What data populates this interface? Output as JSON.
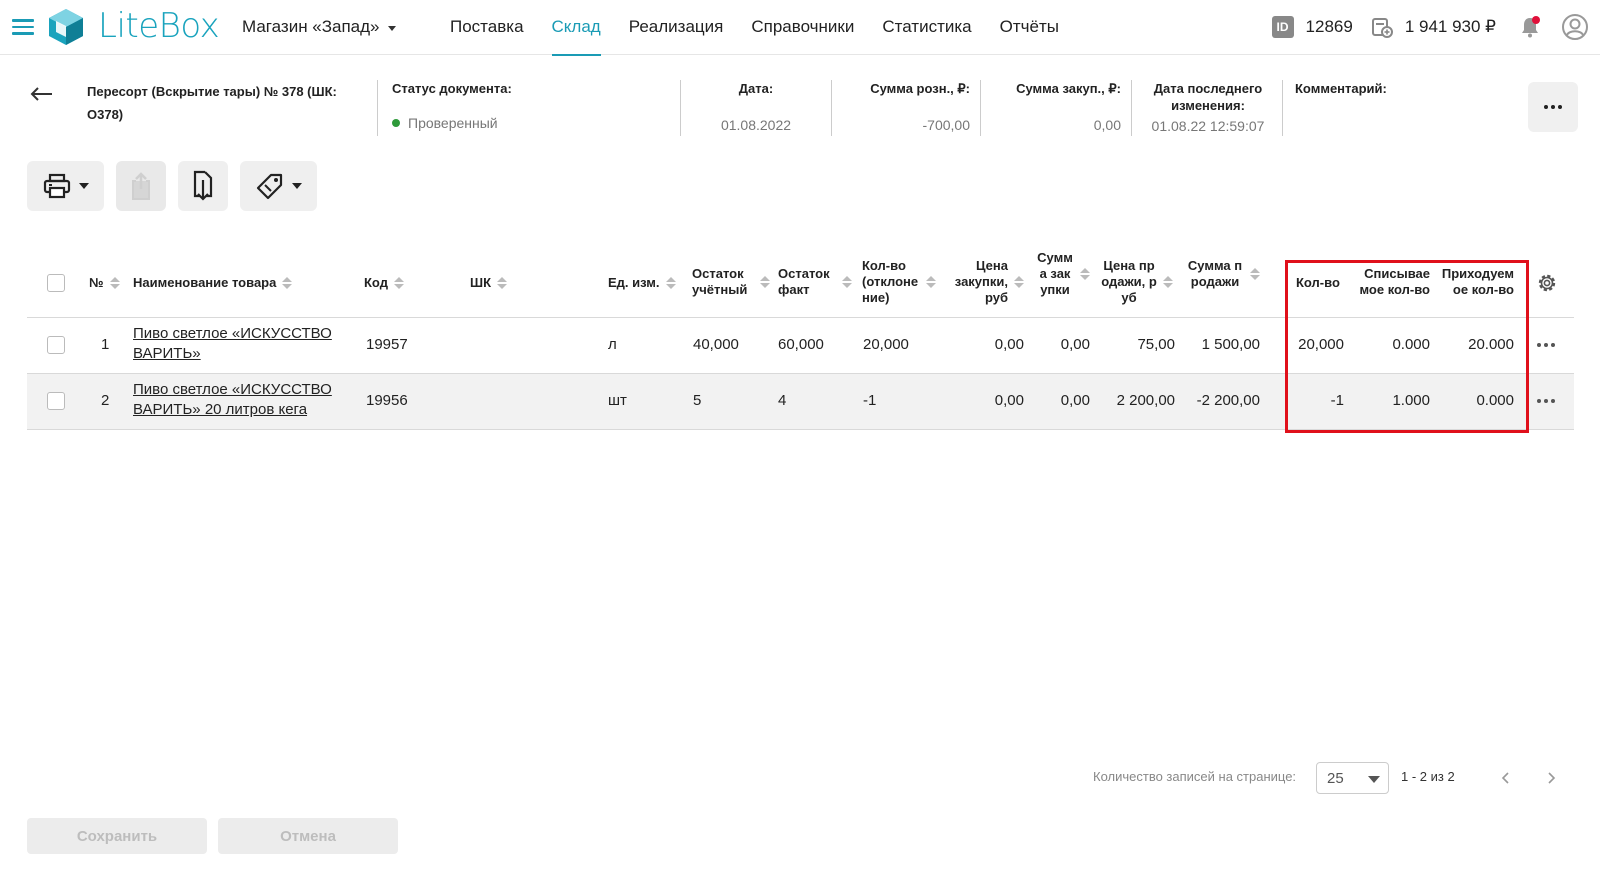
{
  "header": {
    "logo_text": "LiteBox",
    "store_name": "Магазин «Запад»",
    "nav": [
      {
        "label": "Поставка"
      },
      {
        "label": "Склад",
        "active": true
      },
      {
        "label": "Реализация"
      },
      {
        "label": "Справочники"
      },
      {
        "label": "Статистика"
      },
      {
        "label": "Отчёты"
      }
    ],
    "id_badge": "ID",
    "id_value": "12869",
    "balance": "1 941 930 ₽",
    "accent_color": "#1a9bb5",
    "notification_color": "#e0103a"
  },
  "document": {
    "title": "Пересорт (Вскрытие тары) № 378 (ШК: O378)",
    "status_label": "Статус документа:",
    "status_value": "Проверенный",
    "date_label": "Дата:",
    "date_value": "01.08.2022",
    "retail_sum_label": "Сумма розн., ₽:",
    "retail_sum_value": "-700,00",
    "purchase_sum_label": "Сумма закуп., ₽:",
    "purchase_sum_value": "0,00",
    "last_change_label": "Дата последнего изменения:",
    "last_change_value": "01.08.22 12:59:07",
    "comment_label": "Комментарий:"
  },
  "table": {
    "headers": {
      "num": "№",
      "name": "Наименование товара",
      "code": "Код",
      "barcode": "ШК",
      "unit": "Ед. изм.",
      "stock_acc": "Остаток учётный",
      "stock_fact": "Остаток факт",
      "qty_dev": "Кол-во (отклонение)",
      "price_purchase": "Цена закупки, руб",
      "sum_purchase": "Сумма закупки",
      "price_sale": "Цена продажи, руб",
      "sum_sale": "Сумма продажи",
      "qty": "Кол-во",
      "qty_writeoff": "Списываемое кол-во",
      "qty_income": "Приходуемое кол-во"
    },
    "rows": [
      {
        "num": "1",
        "name": "Пиво светлое «ИСКУССТВО ВАРИТЬ»",
        "code": "19957",
        "barcode": "",
        "unit": "л",
        "stock_acc": "40,000",
        "stock_fact": "60,000",
        "qty_dev": "20,000",
        "price_purchase": "0,00",
        "sum_purchase": "0,00",
        "price_sale": "75,00",
        "sum_sale": "1 500,00",
        "qty": "20,000",
        "qty_writeoff": "0.000",
        "qty_income": "20.000"
      },
      {
        "num": "2",
        "name": "Пиво светлое «ИСКУССТВО ВАРИТЬ» 20 литров кега",
        "code": "19956",
        "barcode": "",
        "unit": "шт",
        "stock_acc": "5",
        "stock_fact": "4",
        "qty_dev": "-1",
        "price_purchase": "0,00",
        "sum_purchase": "0,00",
        "price_sale": "2 200,00",
        "sum_sale": "-2 200,00",
        "qty": "-1",
        "qty_writeoff": "1.000",
        "qty_income": "0.000"
      }
    ]
  },
  "pagination": {
    "label": "Количество записей на странице:",
    "per_page": "25",
    "range": "1 - 2 из 2"
  },
  "footer": {
    "save_label": "Сохранить",
    "cancel_label": "Отмена"
  }
}
